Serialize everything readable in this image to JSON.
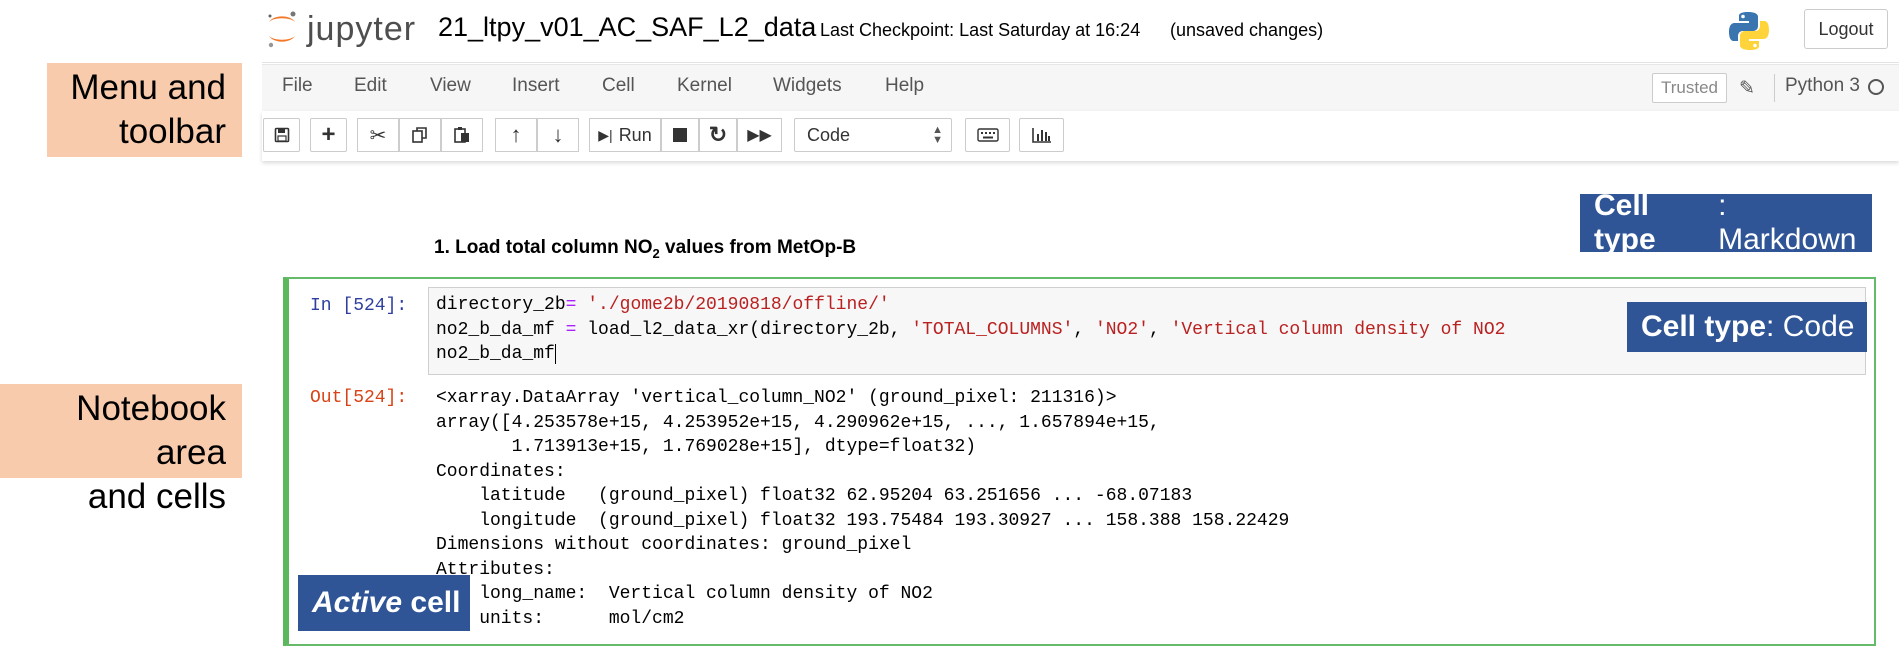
{
  "header": {
    "logo_text": "jupyter",
    "notebook_title": "21_ltpy_v01_AC_SAF_L2_data",
    "checkpoint": "Last Checkpoint: Last Saturday at 16:24",
    "unsaved": "(unsaved changes)",
    "logout_label": "Logout"
  },
  "menu": {
    "items": [
      "File",
      "Edit",
      "View",
      "Insert",
      "Cell",
      "Kernel",
      "Widgets",
      "Help"
    ],
    "trusted_label": "Trusted",
    "kernel_name": "Python 3"
  },
  "toolbar": {
    "icons": [
      "save-icon",
      "plus-icon",
      "cut-icon",
      "copy-icon",
      "paste-icon",
      "arrow-up-icon",
      "arrow-down-icon",
      "run-icon",
      "stop-icon",
      "restart-icon",
      "fast-forward-icon",
      "keyboard-icon",
      "bar-chart-icon"
    ],
    "run_label": "Run",
    "cell_type_value": "Code"
  },
  "notebook": {
    "markdown_heading_pre": "1. Load total column NO",
    "markdown_heading_sub": "2",
    "markdown_heading_post": " values from MetOp-B",
    "in_prompt": "In [524]:",
    "out_prompt": "Out[524]:",
    "code": {
      "line1_a": "directory_2b",
      "line1_b": "=",
      "line1_c": " './gome2b/20190818/offline/'",
      "line2_a": "no2_b_da_mf ",
      "line2_b": "=",
      "line2_c": " load_l2_data_xr(directory_2b, ",
      "line2_d": "'TOTAL_COLUMNS'",
      "line2_e": ", ",
      "line2_f": "'NO2'",
      "line2_g": ", ",
      "line2_h": "'Vertical column density of NO2",
      "line3": "no2_b_da_mf"
    },
    "output_lines": [
      "<xarray.DataArray 'vertical_column_NO2' (ground_pixel: 211316)>",
      "array([4.253578e+15, 4.253952e+15, 4.290962e+15, ..., 1.657894e+15,",
      "       1.713913e+15, 1.769028e+15], dtype=float32)",
      "Coordinates:",
      "    latitude   (ground_pixel) float32 62.95204 63.251656 ... -68.07183",
      "    longitude  (ground_pixel) float32 193.75484 193.30927 ... 158.388 158.22429",
      "Dimensions without coordinates: ground_pixel",
      "Attributes:",
      "    long_name:  Vertical column density of NO2",
      "    units:      mol/cm2"
    ]
  },
  "annotations": {
    "menu_toolbar_line1": "Menu and",
    "menu_toolbar_line2": "toolbar",
    "notebook_line1": "Notebook area",
    "notebook_line2": "and cells",
    "markdown_bold": "Cell type",
    "markdown_rest": ": Markdown",
    "code_bold": "Cell type",
    "code_rest": ": Code",
    "active_italic": "Active",
    "active_rest": " cell"
  }
}
